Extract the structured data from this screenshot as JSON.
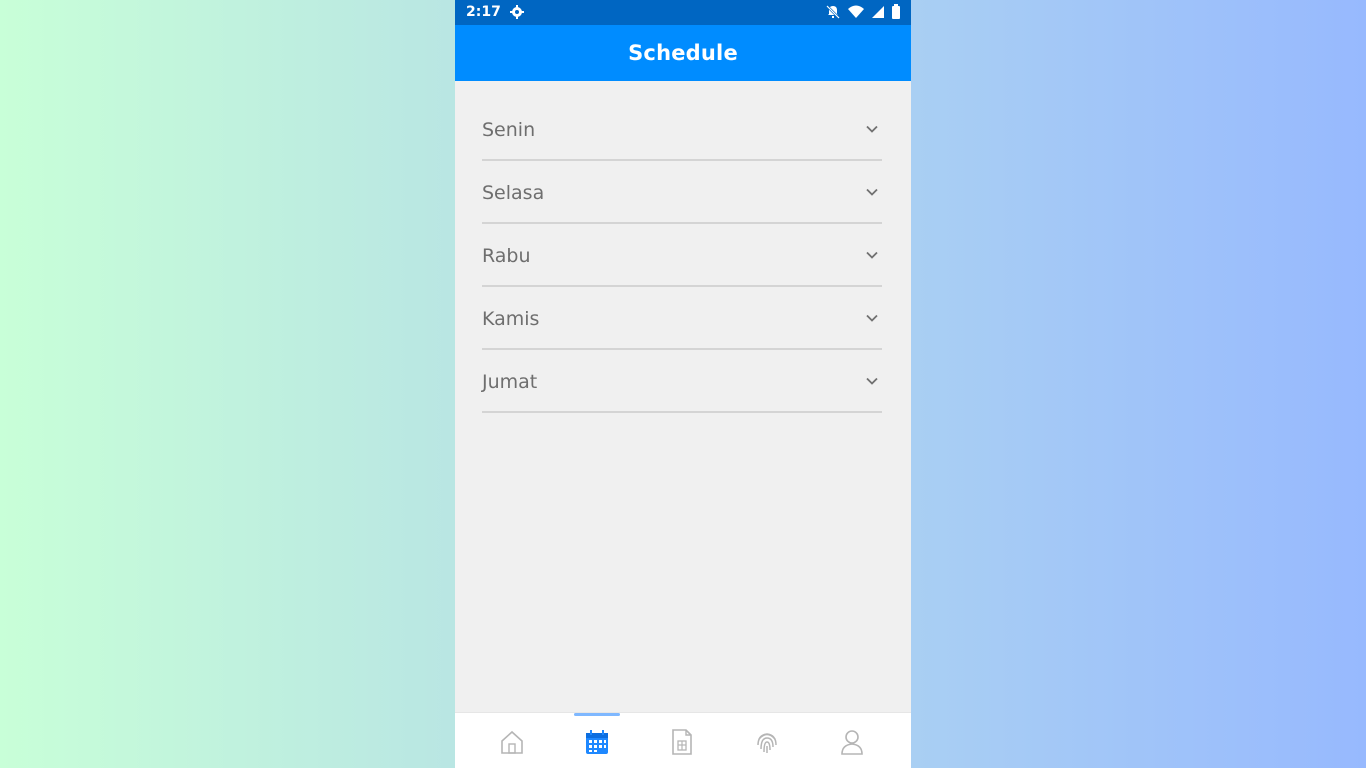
{
  "status_bar": {
    "time": "2:17",
    "icons": [
      "settings-icon",
      "notifications-off-icon",
      "wifi-icon",
      "signal-icon",
      "battery-icon"
    ]
  },
  "app_bar": {
    "title": "Schedule"
  },
  "days": [
    {
      "label": "Senin"
    },
    {
      "label": "Selasa"
    },
    {
      "label": "Rabu"
    },
    {
      "label": "Kamis"
    },
    {
      "label": "Jumat"
    }
  ],
  "bottom_nav": {
    "items": [
      "home-icon",
      "calendar-icon",
      "document-icon",
      "fingerprint-icon",
      "profile-icon"
    ],
    "active": "calendar-icon"
  },
  "colors": {
    "status_bar": "#0066c2",
    "app_bar": "#008cff",
    "content_bg": "#f0f0f0",
    "active_nav": "#1e88ff",
    "inactive_nav": "#b5b5b5"
  }
}
